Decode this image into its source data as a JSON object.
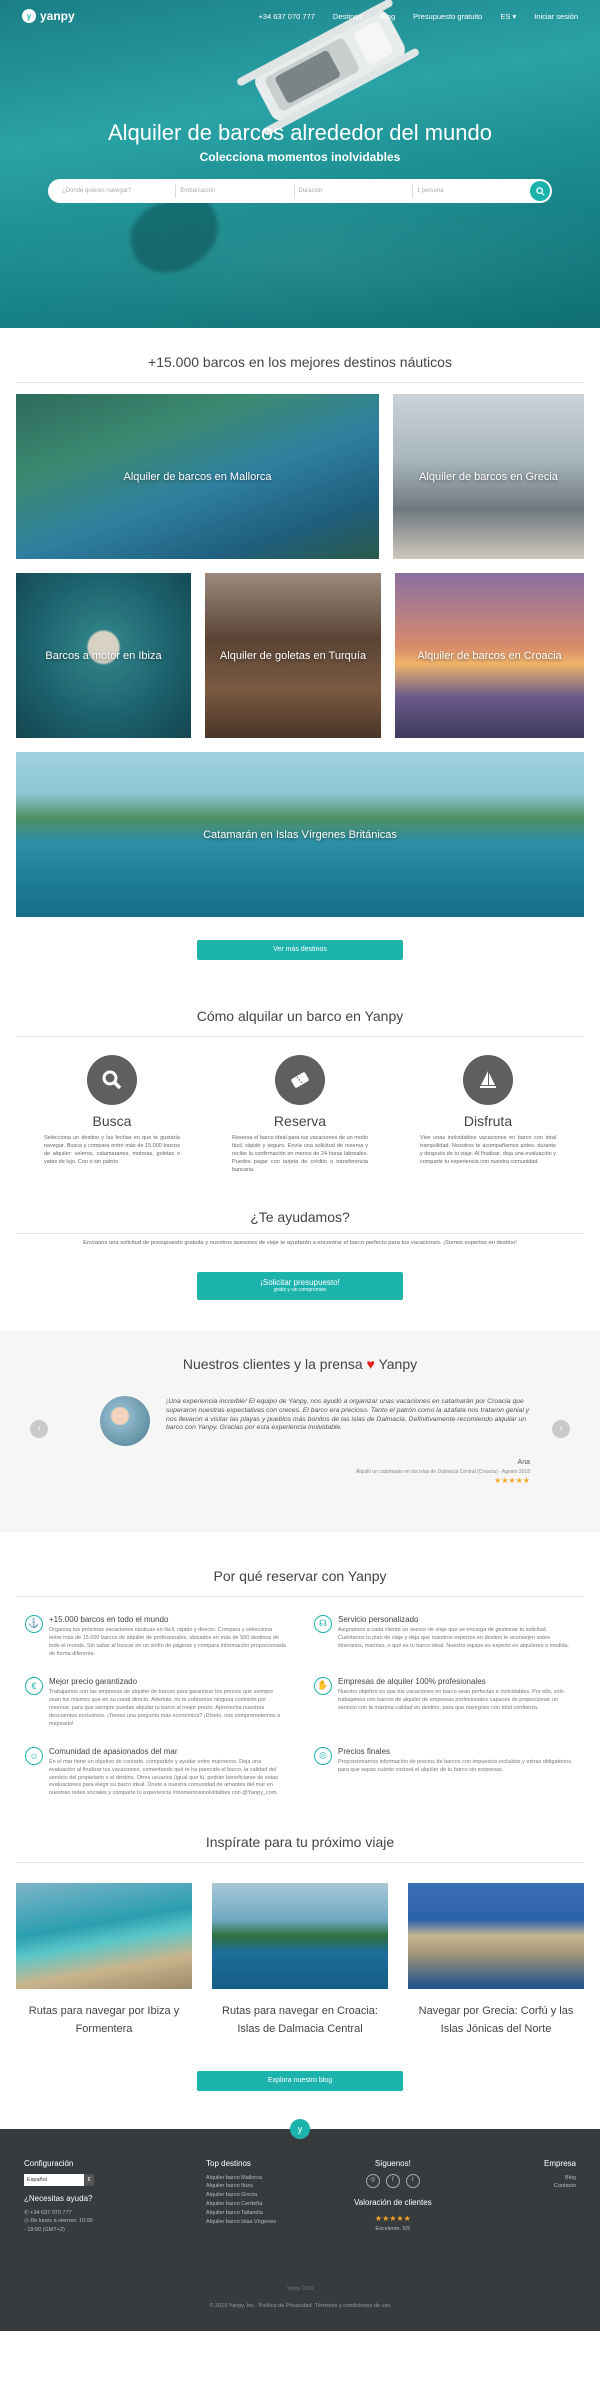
{
  "nav": {
    "logo": "yanpy",
    "phone": "+34 637 070 777",
    "destinos": "Destinos",
    "blog": "Blog",
    "presupuesto": "Presupuesto gratuito",
    "lang": "ES",
    "login": "Iniciar sesión"
  },
  "hero": {
    "title": "Alquiler de barcos alrededor del mundo",
    "subtitle": "Colecciona momentos inolvidables",
    "search": {
      "where": "¿Dónde quieres navegar?",
      "type": "Embarcación",
      "duration": "Duración",
      "people": "1 persona"
    }
  },
  "destinations": {
    "title": "+15.000 barcos en los mejores destinos náuticos",
    "cards": [
      "Alquiler de barcos en Mallorca",
      "Alquiler de barcos en Grecia",
      "Barcos a motor en Ibiza",
      "Alquiler de goletas en Turquía",
      "Alquiler de barcos en Croacia",
      "Catamarán en Islas Vírgenes Británicas"
    ],
    "button": "Ver más destinos"
  },
  "how": {
    "title": "Cómo alquilar un barco en Yanpy",
    "steps": [
      {
        "title": "Busca",
        "icon": "search-icon",
        "text": "Selecciona un destino y las fechas en que te gustaría navegar. Busca y compara entre más de 15.000 barcos de alquiler: veleros, catamaranes, motoras, goletas o yates de lujo. Con o sin patrón."
      },
      {
        "title": "Reserva",
        "icon": "ticket-icon",
        "text": "Reserva el barco ideal para tus vacaciones de un modo fácil, rápido y seguro. Envía una solicitud de reserva y recibe la confirmación en menos de 24 horas laborales. Puedes pagar con tarjeta de crédito o transferencia bancaria."
      },
      {
        "title": "Disfruta",
        "icon": "sailboat-icon",
        "text": "Vive unas inolvidables vacaciones en barco con total tranquilidad. Nosotros te acompañamos antes, durante y después de tu viaje. Al finalizar, deja una evaluación y comparte tu experiencia con nuestra comunidad."
      }
    ]
  },
  "help": {
    "title": "¿Te ayudamos?",
    "text": "Envíanos una solicitud de presupuesto gratuita y nuestros asesores de viaje te ayudarán a encontrar el barco perfecto para tus vacaciones. ¡Somos expertos en destino!",
    "button": "¡Solicitar presupuesto!",
    "button_sub": "gratis y sin compromiso"
  },
  "testimonials": {
    "title_a": "Nuestros clientes y la prensa",
    "title_b": "Yanpy",
    "quote": "¡Una experiencia increíble! El equipo de Yanpy, nos ayudó a organizar unas vacaciones en catamarán por Croacia que superaron nuestras expectativas con creces. El barco era precioso. Tanto el patrón como la azafata nos trataron genial y nos llevaron a visitar las playas y pueblos más bonitos de las islas de Dalmacia. Definitivamente recomiendo alquilar un barco con Yanpy. Gracias por esta experiencia inolvidable.",
    "author": "Ana",
    "caption": "Alquiló un catamarán en las islas de Dalmacia Central (Croacia) · Agosto 2018",
    "stars": "★★★★★"
  },
  "why": {
    "title": "Por qué reservar con Yanpy",
    "items": [
      {
        "title": "+15.000 barcos en todo el mundo",
        "icon": "anchor-icon",
        "text": "Organiza tus próximas vacaciones náuticas en fácil, rápido y directo. Compara y selecciona entre más de 15.000 barcos de alquiler de profesionales, ubicados en más de 500 destinos de todo el mundo. Sin saltar al buscar en un sinfín de páginas y compara información proporcionada de forma diferente."
      },
      {
        "title": "Servicio personalizado",
        "icon": "headset-icon",
        "text": "Asignamos a cada cliente un asesor de viaje que se encarga de gestionar tu solicitud. Cuéntanos tu plan de viaje y deja que nuestros expertos en destino te aconsejen sobre itinerarios, marinas, o qué es tu barco ideal. Nuestro equipo es experto en alquileres a medida."
      },
      {
        "title": "Mejor precio garantizado",
        "icon": "euro-icon",
        "text": "Trabajamos con las empresas de alquiler de barcos para garantizar los precios que siempre sean los mismos que en su canal directo. Además, no te cobramos ninguna comisión por reservar, para que siempre puedas alquilar tu barco al mejor precio. Aprovecha nuestros descuentos exclusivos. ¡Tienes una pregunta más económica? ¡Díselo, nos comprometemos a mejorarlo!"
      },
      {
        "title": "Empresas de alquiler 100% profesionales",
        "icon": "handshake-icon",
        "text": "Nuestro objetivo es que tus vacaciones en barco sean perfectas e inolvidables. Por ello, sólo trabajamos con barcos de alquiler de empresas profesionales capaces de proporcionar un servicio con la máxima calidad en destino, para que navegues con total confianza."
      },
      {
        "title": "Comunidad de apasionados del mar",
        "icon": "community-icon",
        "text": "En el mar tiene un objetivo de contarte, compartirlo y ayudar entre marineros. Deja una evaluación al finalizar tus vacaciones, comentando qué te ha parecido el barco, la calidad del servicio del propietario o el destino. Otros usuarios (igual que tú, podrán beneficiarse de estas evaluaciones para elegir su barco ideal. Únete a nuestra comunidad de amantes del mar en nuestras redes sociales y comparte tu experiencia #momentosinolvidables con @Yanpy_com."
      },
      {
        "title": "Precios finales",
        "icon": "price-icon",
        "text": "Proporcionamos información de precios de barcos con impuestos incluidos y extras obligatorios, para que sepas cuánto costará el alquiler de tu barco sin sorpresas."
      }
    ]
  },
  "inspire": {
    "title": "Inspírate para tu próximo viaje",
    "posts": [
      "Rutas para navegar por Ibiza y Formentera",
      "Rutas para navegar en Croacia: Islas de Dalmacia Central",
      "Navegar por Grecia: Corfú y las Islas Jónicas del Norte"
    ],
    "button": "Explora nuestro blog"
  },
  "footer": {
    "config_title": "Configuración",
    "config_lang": "Español",
    "config_currency": "€",
    "help_title": "¿Necesitas ayuda?",
    "help_phone": "+34 637 070 777",
    "help_hours": "De lunes a viernes: 10:00 - 19:00 (GMT+2)",
    "top_title": "Top destinos",
    "top_items": [
      "Alquiler barco Mallorca",
      "Alquiler barco Ibiza",
      "Alquiler barco Grecia",
      "Alquiler barco Cerdeña",
      "Alquiler barco Tailandia",
      "Alquiler barco Islas Vírgenes"
    ],
    "follow_title": "Síguenos!",
    "rating_title": "Valoración de clientes",
    "rating_stars": "★★★★★",
    "rating_text": "Excelente. 5/5",
    "company_title": "Empresa",
    "company_items": [
      "Blog",
      "Contacto"
    ],
    "bottom_top": "Yanpy 2019",
    "copyright": "© 2019 Yanpy, Inc.",
    "privacy": "Política de Privacidad",
    "terms": "Términos y condiciones de uso"
  }
}
